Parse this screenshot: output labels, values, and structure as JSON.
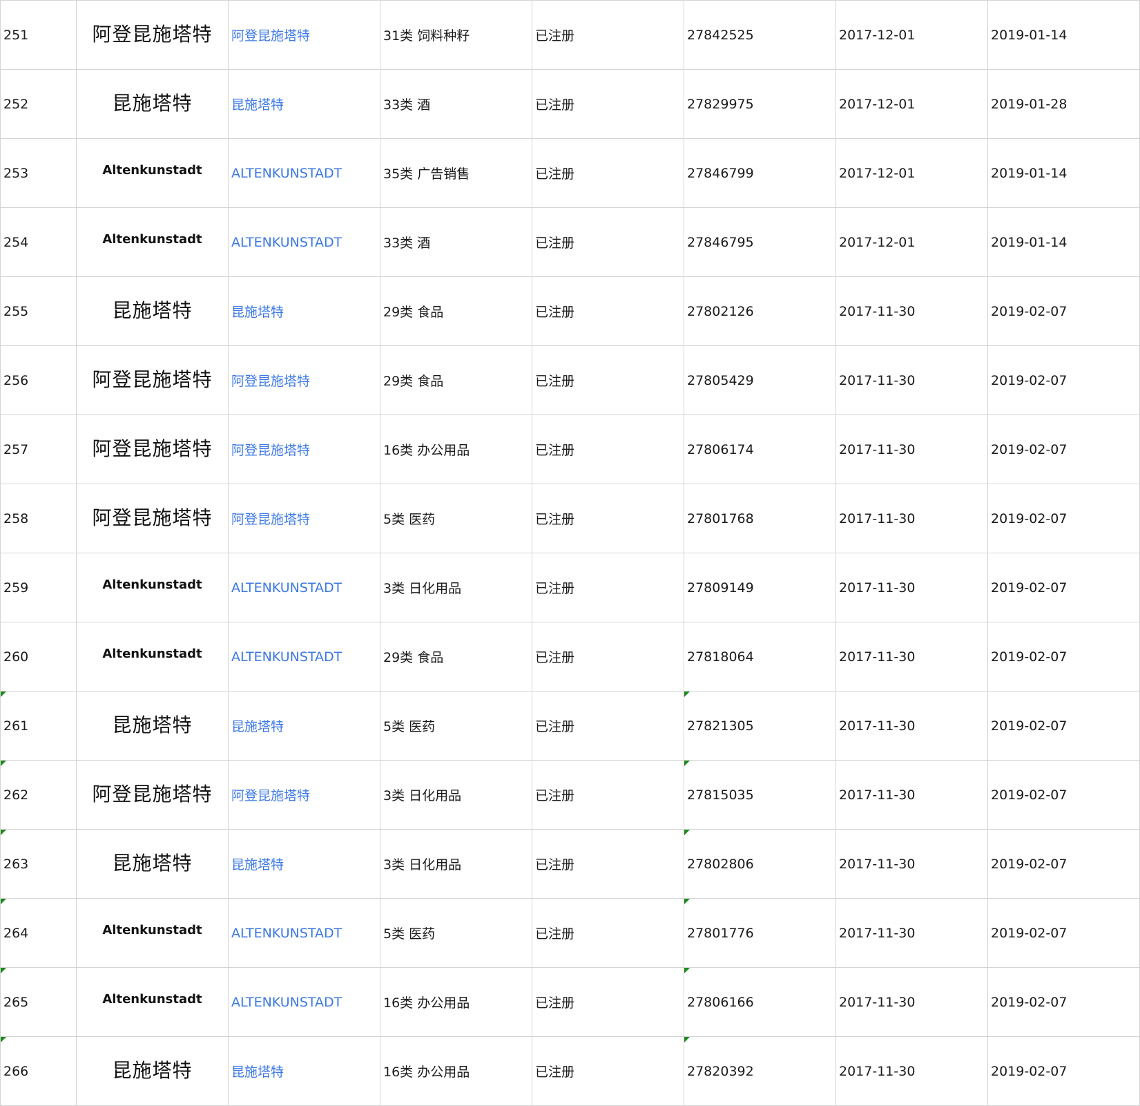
{
  "rows": [
    {
      "no": "251",
      "logo": "阿登昆施塔特",
      "logo_type": "cn",
      "name": "阿登昆施塔特",
      "class": "31类 饲料种籽",
      "status": "已注册",
      "reg_no": "27842525",
      "apply_date": "2017-12-01",
      "pub_date": "2019-01-14",
      "flag": false
    },
    {
      "no": "252",
      "logo": "昆施塔特",
      "logo_type": "cn",
      "name": "昆施塔特",
      "class": "33类 酒",
      "status": "已注册",
      "reg_no": "27829975",
      "apply_date": "2017-12-01",
      "pub_date": "2019-01-28",
      "flag": false
    },
    {
      "no": "253",
      "logo": "Altenkunstadt",
      "logo_type": "en",
      "name": "ALTENKUNSTADT",
      "class": "35类 广告销售",
      "status": "已注册",
      "reg_no": "27846799",
      "apply_date": "2017-12-01",
      "pub_date": "2019-01-14",
      "flag": false
    },
    {
      "no": "254",
      "logo": "Altenkunstadt",
      "logo_type": "en",
      "name": "ALTENKUNSTADT",
      "class": "33类 酒",
      "status": "已注册",
      "reg_no": "27846795",
      "apply_date": "2017-12-01",
      "pub_date": "2019-01-14",
      "flag": false
    },
    {
      "no": "255",
      "logo": "昆施塔特",
      "logo_type": "cn",
      "name": "昆施塔特",
      "class": "29类 食品",
      "status": "已注册",
      "reg_no": "27802126",
      "apply_date": "2017-11-30",
      "pub_date": "2019-02-07",
      "flag": false
    },
    {
      "no": "256",
      "logo": "阿登昆施塔特",
      "logo_type": "cn",
      "name": "阿登昆施塔特",
      "class": "29类 食品",
      "status": "已注册",
      "reg_no": "27805429",
      "apply_date": "2017-11-30",
      "pub_date": "2019-02-07",
      "flag": false
    },
    {
      "no": "257",
      "logo": "阿登昆施塔特",
      "logo_type": "cn",
      "name": "阿登昆施塔特",
      "class": "16类 办公用品",
      "status": "已注册",
      "reg_no": "27806174",
      "apply_date": "2017-11-30",
      "pub_date": "2019-02-07",
      "flag": false
    },
    {
      "no": "258",
      "logo": "阿登昆施塔特",
      "logo_type": "cn",
      "name": "阿登昆施塔特",
      "class": "5类 医药",
      "status": "已注册",
      "reg_no": "27801768",
      "apply_date": "2017-11-30",
      "pub_date": "2019-02-07",
      "flag": false
    },
    {
      "no": "259",
      "logo": "Altenkunstadt",
      "logo_type": "en",
      "name": "ALTENKUNSTADT",
      "class": "3类 日化用品",
      "status": "已注册",
      "reg_no": "27809149",
      "apply_date": "2017-11-30",
      "pub_date": "2019-02-07",
      "flag": false
    },
    {
      "no": "260",
      "logo": "Altenkunstadt",
      "logo_type": "en",
      "name": "ALTENKUNSTADT",
      "class": "29类 食品",
      "status": "已注册",
      "reg_no": "27818064",
      "apply_date": "2017-11-30",
      "pub_date": "2019-02-07",
      "flag": false
    },
    {
      "no": "261",
      "logo": "昆施塔特",
      "logo_type": "cn",
      "name": "昆施塔特",
      "class": "5类 医药",
      "status": "已注册",
      "reg_no": "27821305",
      "apply_date": "2017-11-30",
      "pub_date": "2019-02-07",
      "flag": true
    },
    {
      "no": "262",
      "logo": "阿登昆施塔特",
      "logo_type": "cn",
      "name": "阿登昆施塔特",
      "class": "3类 日化用品",
      "status": "已注册",
      "reg_no": "27815035",
      "apply_date": "2017-11-30",
      "pub_date": "2019-02-07",
      "flag": true
    },
    {
      "no": "263",
      "logo": "昆施塔特",
      "logo_type": "cn",
      "name": "昆施塔特",
      "class": "3类 日化用品",
      "status": "已注册",
      "reg_no": "27802806",
      "apply_date": "2017-11-30",
      "pub_date": "2019-02-07",
      "flag": true
    },
    {
      "no": "264",
      "logo": "Altenkunstadt",
      "logo_type": "en",
      "name": "ALTENKUNSTADT",
      "class": "5类 医药",
      "status": "已注册",
      "reg_no": "27801776",
      "apply_date": "2017-11-30",
      "pub_date": "2019-02-07",
      "flag": true
    },
    {
      "no": "265",
      "logo": "Altenkunstadt",
      "logo_type": "en",
      "name": "ALTENKUNSTADT",
      "class": "16类 办公用品",
      "status": "已注册",
      "reg_no": "27806166",
      "apply_date": "2017-11-30",
      "pub_date": "2019-02-07",
      "flag": true
    },
    {
      "no": "266",
      "logo": "昆施塔特",
      "logo_type": "cn",
      "name": "昆施塔特",
      "class": "16类 办公用品",
      "status": "已注册",
      "reg_no": "27820392",
      "apply_date": "2017-11-30",
      "pub_date": "2019-02-07",
      "flag": true
    }
  ],
  "colors": {
    "grid": "#d4d4d4",
    "link_text": "#3b78e7",
    "body_text": "#1a1a1a",
    "flag_marker": "#1d8a1d"
  }
}
